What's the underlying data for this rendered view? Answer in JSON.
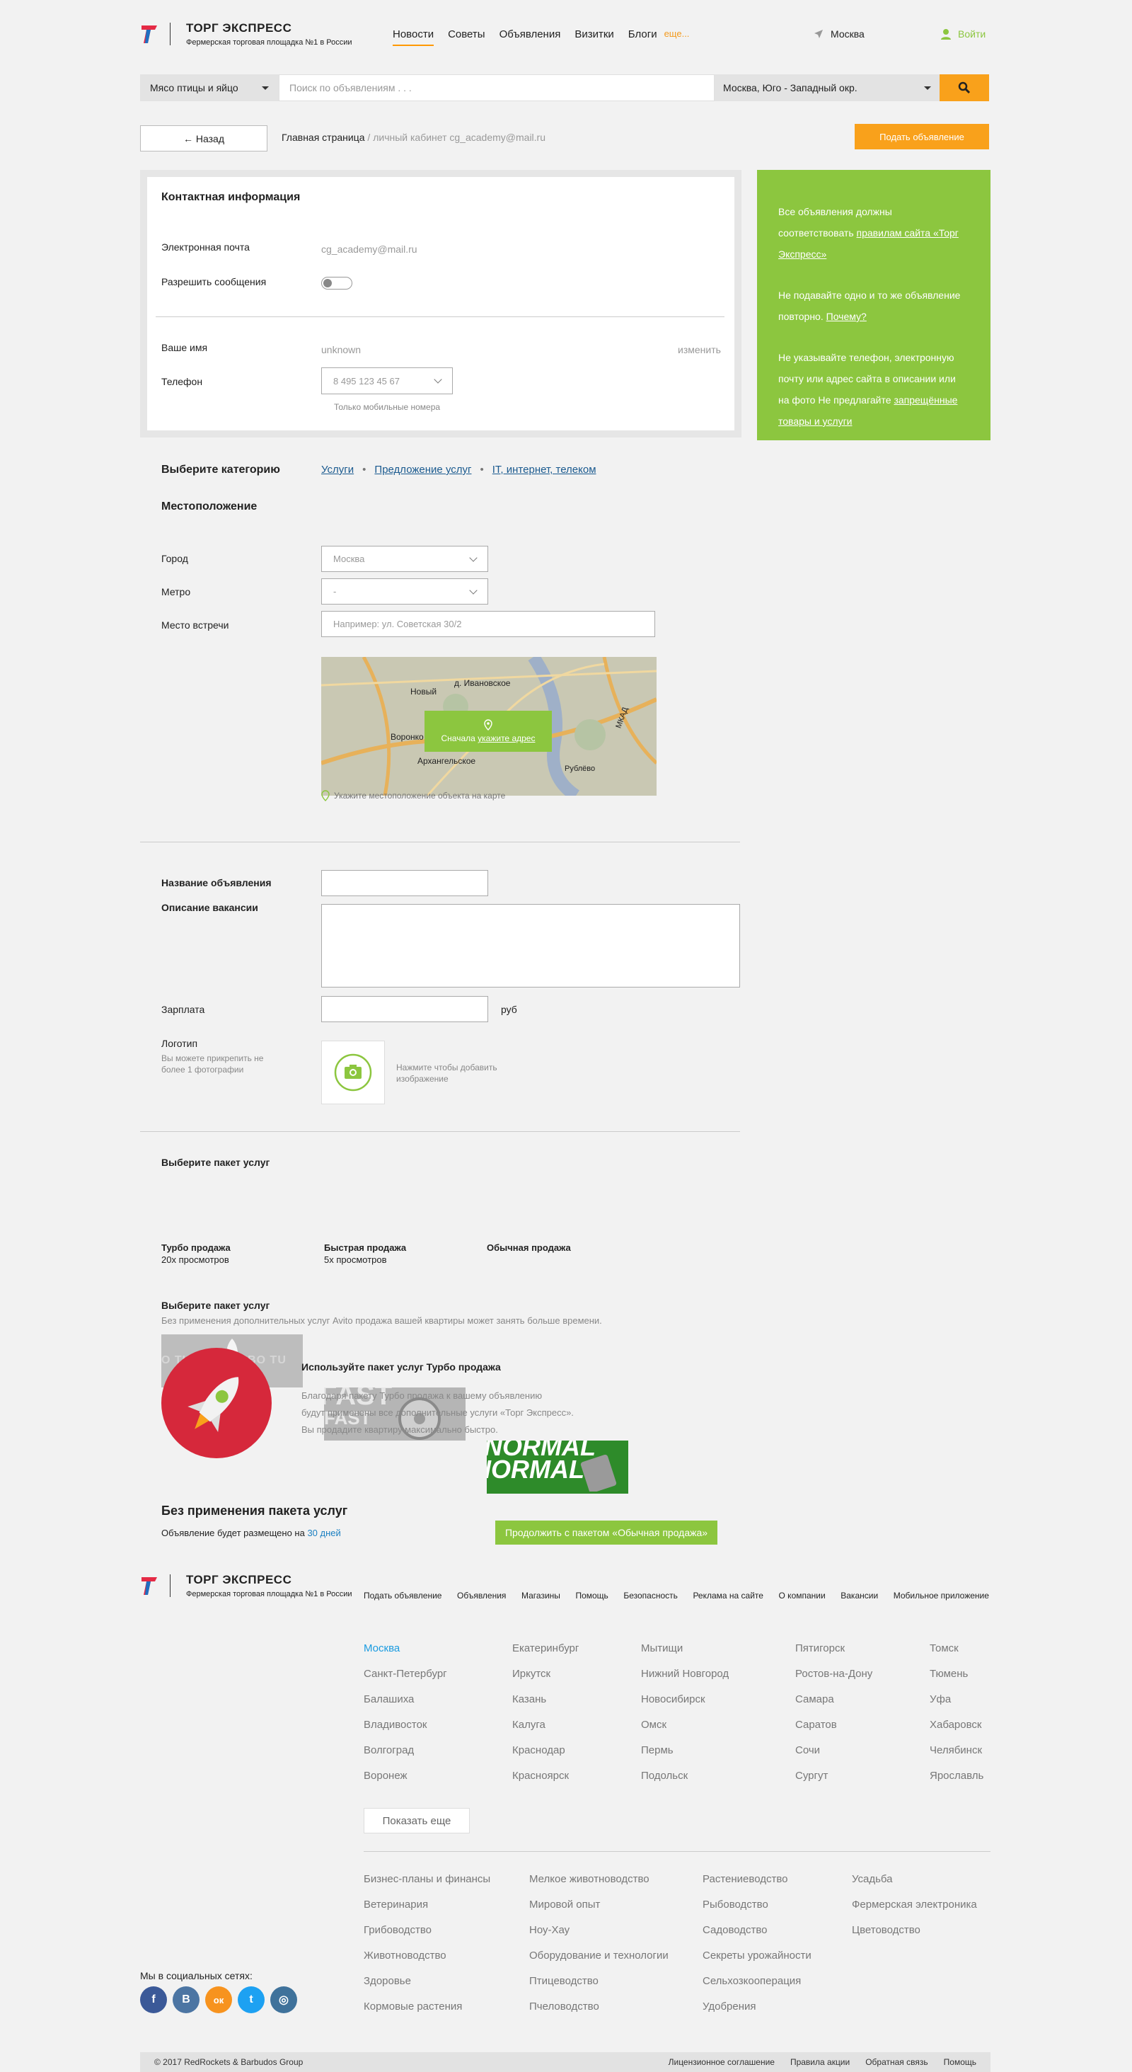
{
  "header": {
    "brand": "ТОРГ ЭКСПРЕСС",
    "tagline": "Фермерская торговая площадка №1 в России",
    "nav": [
      "Новости",
      "Советы",
      "Объявления",
      "Визитки",
      "Блоги"
    ],
    "more": "еще...",
    "city": "Москва",
    "login": "Войти"
  },
  "search": {
    "category": "Мясо птицы и яйцо",
    "placeholder": "Поиск по объявлениям . . .",
    "region": "Москва, Юго - Западный окр."
  },
  "crumbs": {
    "back": "Назад",
    "home": "Главная страница",
    "rest": " / личный кабинет cg_academy@mail.ru",
    "post_button": "Подать объявление"
  },
  "contact": {
    "title": "Контактная информация",
    "email_label": "Электронная почта",
    "email_value": "cg_academy@mail.ru",
    "allow_label": "Разрешить сообщения",
    "name_label": "Ваше имя",
    "name_value": "unknown",
    "change": "изменить",
    "phone_label": "Телефон",
    "phone_value": "8 495 123 45 67",
    "phone_hint": "Только мобильные номера"
  },
  "info": {
    "p1a": "Все объявления должны соответствовать ",
    "p1b": "правилам сайта «Торг Экспресс»",
    "p2a": "Не подавайте одно и то же объявление повторно. ",
    "p2b": "Почему?",
    "p3a": "Не указывайте телефон, электронную почту или адрес сайта в описании или на фото Не предлагайте ",
    "p3b": "запрещённые товары и услуги"
  },
  "category": {
    "label": "Выберите категорию",
    "items": [
      "Услуги",
      "Предложение услуг",
      "IT, интернет, телеком"
    ]
  },
  "location": {
    "title": "Местоположение",
    "city_label": "Город",
    "city_value": "Москва",
    "metro_label": "Метро",
    "metro_value": "-",
    "meet_label": "Место встречи",
    "meet_placeholder": "Например: ул. Советская 30/2",
    "map_btn_a": "Сначала ",
    "map_btn_b": "укажите адрес",
    "map_hint": "Укажите местоположение объекта на карте",
    "map_labels": [
      "Новый",
      "д. Ивановское",
      "Воронко",
      "Архангельское",
      "Рублёво",
      "МКАД"
    ]
  },
  "ad": {
    "title_label": "Название объявления",
    "desc_label": "Описание вакансии",
    "salary_label": "Зарплата",
    "currency": "руб",
    "logo_label": "Логотип",
    "logo_hint": "Вы можете прикрепить не более 1 фотографии",
    "upload_hint": "Нажмите чтобы добавить изображение"
  },
  "packages": {
    "title": "Выберите пакет услуг",
    "items": [
      {
        "name": "Турбо продажа",
        "views": "20x просмотров",
        "art": "O TURBO TURBO TU"
      },
      {
        "name": "Быстрая продажа",
        "views": "5x просмотров",
        "art": "FAST"
      },
      {
        "name": "Обычная продажа",
        "views": "",
        "art": "NORMAL"
      }
    ]
  },
  "promo": {
    "title": "Выберите пакет услуг",
    "subtitle": "Без применения дополнительных услуг Avito продажа вашей квартиры может занять больше времени.",
    "heading": "Используйте пакет услуг Турбо продажа",
    "lines": [
      "Благодаря пакету Турбо продажа к вашему объявлению",
      "будут применены все дополнительные услуги «Торг Экспресс».",
      "Вы продадите квартиру максимально быстро."
    ]
  },
  "nopkg": {
    "title": "Без применения пакета услуг",
    "text": "Объявление будет размещено на ",
    "days": "30 дней",
    "button": "Продолжить с пакетом «Обычная продажа»"
  },
  "footer": {
    "links": [
      "Подать объявление",
      "Объявления",
      "Магазины",
      "Помощь",
      "Безопасность",
      "Реклама на сайте",
      "О компании",
      "Вакансии",
      "Мобильное приложение"
    ],
    "cities": [
      "Москва",
      "Екатеринбург",
      "Мытищи",
      "Пятигорск",
      "Томск",
      "Санкт-Петербург",
      "Иркутск",
      "Нижний Новгород",
      "Ростов-на-Дону",
      "Тюмень",
      "Балашиха",
      "Казань",
      "Новосибирск",
      "Самара",
      "Уфа",
      "Владивосток",
      "Калуга",
      "Омск",
      "Саратов",
      "Хабаровск",
      "Волгоград",
      "Краснодар",
      "Пермь",
      "Сочи",
      "Челябинск",
      "Воронеж",
      "Красноярск",
      "Подольск",
      "Сургут",
      "Ярославль"
    ],
    "show_more": "Показать еще",
    "topics": [
      "Бизнес-планы и финансы",
      "Мелкое животноводство",
      "Растениеводство",
      "Усадьба",
      "Ветеринария",
      "Мировой опыт",
      "Рыбоводство",
      "Фермерская электроника",
      "Грибоводство",
      "Ноу-Хау",
      "Садоводство",
      "Цветоводство",
      "Животноводство",
      "Оборудование и технологии",
      "Секреты урожайности",
      "",
      "Здоровье",
      "Птицеводство",
      "Сельхозкооперация",
      "",
      "Кормовые растения",
      "Пчеловодство",
      "Удобрения",
      ""
    ],
    "social_label": "Мы в социальных сетях:",
    "social": [
      "f",
      "В",
      "ок",
      "t",
      "◎"
    ],
    "copyright": "© 2017 RedRockets & Barbudos Group",
    "bottom_links": [
      "Лицензионное соглашение",
      "Правила акции",
      "Обратная связь",
      "Помощь"
    ]
  },
  "colors": {
    "accent": "#f9a11b",
    "green": "#8cc63f",
    "link": "#1a5a8f"
  }
}
